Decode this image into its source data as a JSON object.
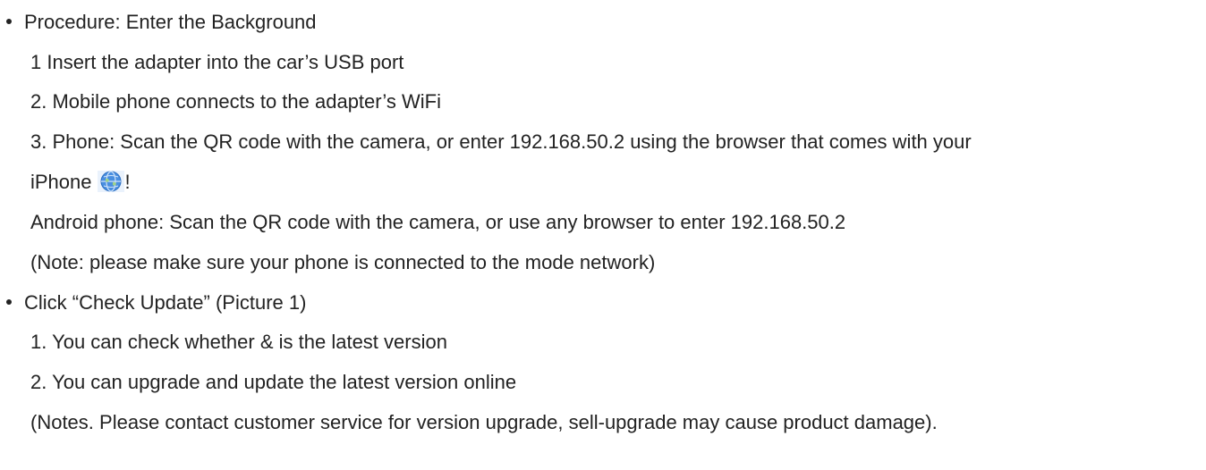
{
  "sections": [
    {
      "heading": "Procedure: Enter the Background",
      "lines": [
        "1 Insert the adapter into the car’s USB port",
        "2. Mobile phone connects to the adapter’s WiFi",
        "3. Phone: Scan the QR code with the camera, or enter 192.168.50.2 using the browser that comes with your",
        "iPhone",
        "!",
        "Android phone: Scan the QR code with the camera, or use any browser to enter 192.168.50.2",
        "(Note: please make sure your phone is connected to the mode network)"
      ]
    },
    {
      "heading": "Click “Check Update” (Picture 1)",
      "lines": [
        "1. You can check whether & is the latest version",
        "2. You can upgrade and update the latest version online",
        "(Notes. Please contact customer service for version upgrade, sell-upgrade may cause product damage)."
      ]
    }
  ],
  "icons": {
    "inline_icon": "globe-icon",
    "inline_icon_color": "#4a8fe0"
  }
}
